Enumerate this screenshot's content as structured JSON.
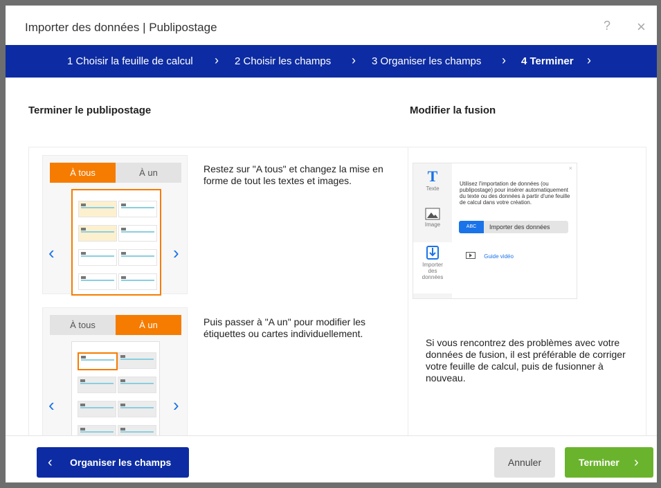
{
  "dialog": {
    "title": "Importer des données | Publipostage",
    "help_icon": "?",
    "close_icon": "×"
  },
  "steps": [
    {
      "label": "1 Choisir la feuille de calcul"
    },
    {
      "label": "2 Choisir les champs"
    },
    {
      "label": "3 Organiser les champs"
    },
    {
      "label": "4 Terminer"
    }
  ],
  "step_separator": "›",
  "left": {
    "heading": "Terminer le publipostage",
    "items": [
      {
        "tab_all": "À tous",
        "tab_one": "À un",
        "description": "Restez sur \"A tous\" et changez la mise en forme de tout les textes et images."
      },
      {
        "tab_all": "À tous",
        "tab_one": "À un",
        "description": "Puis passer à \"A un\" pour modifier les étiquettes ou cartes individuellement."
      }
    ],
    "prev_arrow": "‹",
    "next_arrow": "›"
  },
  "right": {
    "heading": "Modifier la fusion",
    "preview": {
      "side_items": [
        "Texte",
        "Image",
        "Importer des données"
      ],
      "text": "Utilisez l'importation de données (ou publipostage) pour insérer automatiquement du texte ou des données à partir d'une feuille de calcul dans votre création.",
      "button_badge": "ABC",
      "button_label": "Importer des données",
      "video_label": "Guide vidéo"
    },
    "text": "Si vous rencontrez des problèmes avec votre données de fusion, il est préférable de corriger votre feuille de calcul, puis de fusionner à nouveau."
  },
  "footer": {
    "back_label": "Organiser les champs",
    "cancel_label": "Annuler",
    "finish_label": "Terminer"
  },
  "colors": {
    "nav_blue": "#0d2ca3",
    "orange": "#f57c00",
    "green": "#6ab42d",
    "link_blue": "#1a73e8"
  }
}
